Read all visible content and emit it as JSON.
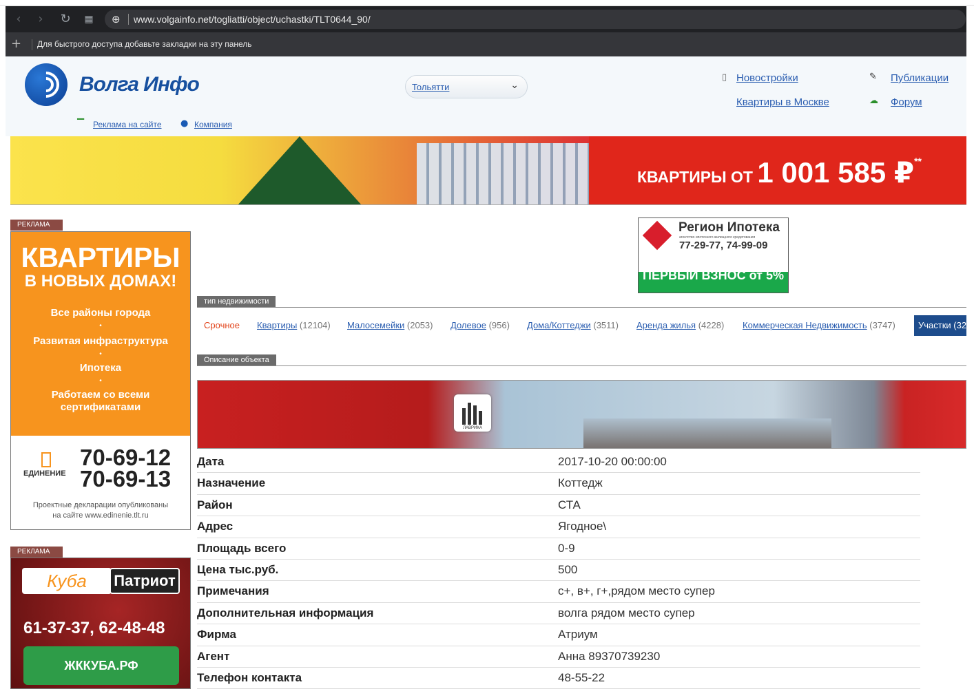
{
  "browser": {
    "url": "www.volgainfo.net/togliatti/object/uchastki/TLT0644_90/",
    "bookmarks_hint": "Для быстрого доступа добавьте закладки на эту панель",
    "icons": [
      "back-icon",
      "forward-icon",
      "reload-icon",
      "apps-icon",
      "globe-icon",
      "plus-icon"
    ]
  },
  "header": {
    "logo_text": "Волга Инфо",
    "ads_link": "Реклама на сайте",
    "company_link": "Компания",
    "city": "Тольятти",
    "links": {
      "new_buildings": "Новостройки",
      "publications": "Публикации",
      "moscow_flats": "Квартиры в Москве",
      "forum": "Форум"
    }
  },
  "top_banner": {
    "text_small": "КВАРТИРЫ ОТ ",
    "text_big": "1 001 585 ₽",
    "mark": "**"
  },
  "left_ad1": {
    "label": "РЕКЛАМА",
    "headline1": "КВАРТИРЫ",
    "headline2": "В НОВЫХ ДОМАХ!",
    "features": [
      "Все районы города",
      "Развитая инфраструктура",
      "Ипотека",
      "Работаем со всеми сертификатами"
    ],
    "bullet": "•",
    "brand": "ЕДИНЕНИЕ",
    "phone1": "70-69-12",
    "phone2": "70-69-13",
    "note_line1": "Проектные декларации опубликованы",
    "note_line2": "на сайте www.edinenie.tlt.ru"
  },
  "left_ad2": {
    "label": "РЕКЛАМА",
    "brand1": "Куба",
    "brand2": "Патриот",
    "phones": "61-37-37, 62-48-48",
    "button": "ЖККУБА.РФ"
  },
  "right_ad": {
    "title": "Регион Ипотека",
    "subtitle": "агентство ипотечного жилищного кредитования",
    "phones": "77-29-77, 74-99-09",
    "strip": "ПЕРВЫЙ ВЗНОС от 5%"
  },
  "sections": {
    "property_type": "тип недвижимости",
    "object_description": "Описание объекта"
  },
  "tabs": [
    {
      "label": "Срочное",
      "count": ""
    },
    {
      "label": "Квартиры",
      "count": "(12104)"
    },
    {
      "label": "Малосемейки",
      "count": "(2053)"
    },
    {
      "label": "Долевое",
      "count": "(956)"
    },
    {
      "label": "Дома/Коттеджи",
      "count": "(3511)"
    },
    {
      "label": "Аренда жилья",
      "count": "(4228)"
    },
    {
      "label": "Коммерческая Недвижимость",
      "count": "(3747)"
    },
    {
      "label": "Участки",
      "count": "(32"
    }
  ],
  "object_banner": {
    "logo_text": "ЛАВРИКА"
  },
  "details": [
    {
      "key": "Дата",
      "value": "2017-10-20 00:00:00"
    },
    {
      "key": "Назначение",
      "value": "Коттедж"
    },
    {
      "key": "Район",
      "value": "СТА"
    },
    {
      "key": "Адрес",
      "value": "Ягодное\\"
    },
    {
      "key": "Площадь всего",
      "value": "0-9"
    },
    {
      "key": "Цена тыс.руб.",
      "value": "500"
    },
    {
      "key": "Примечания",
      "value": "с+, в+, г+,рядом место супер"
    },
    {
      "key": "Дополнительная информация",
      "value": "волга рядом место супер"
    },
    {
      "key": "Фирма",
      "value": "Атриум"
    },
    {
      "key": "Агент",
      "value": "Анна 89370739230"
    },
    {
      "key": "Телефон контакта",
      "value": "48-55-22"
    }
  ]
}
